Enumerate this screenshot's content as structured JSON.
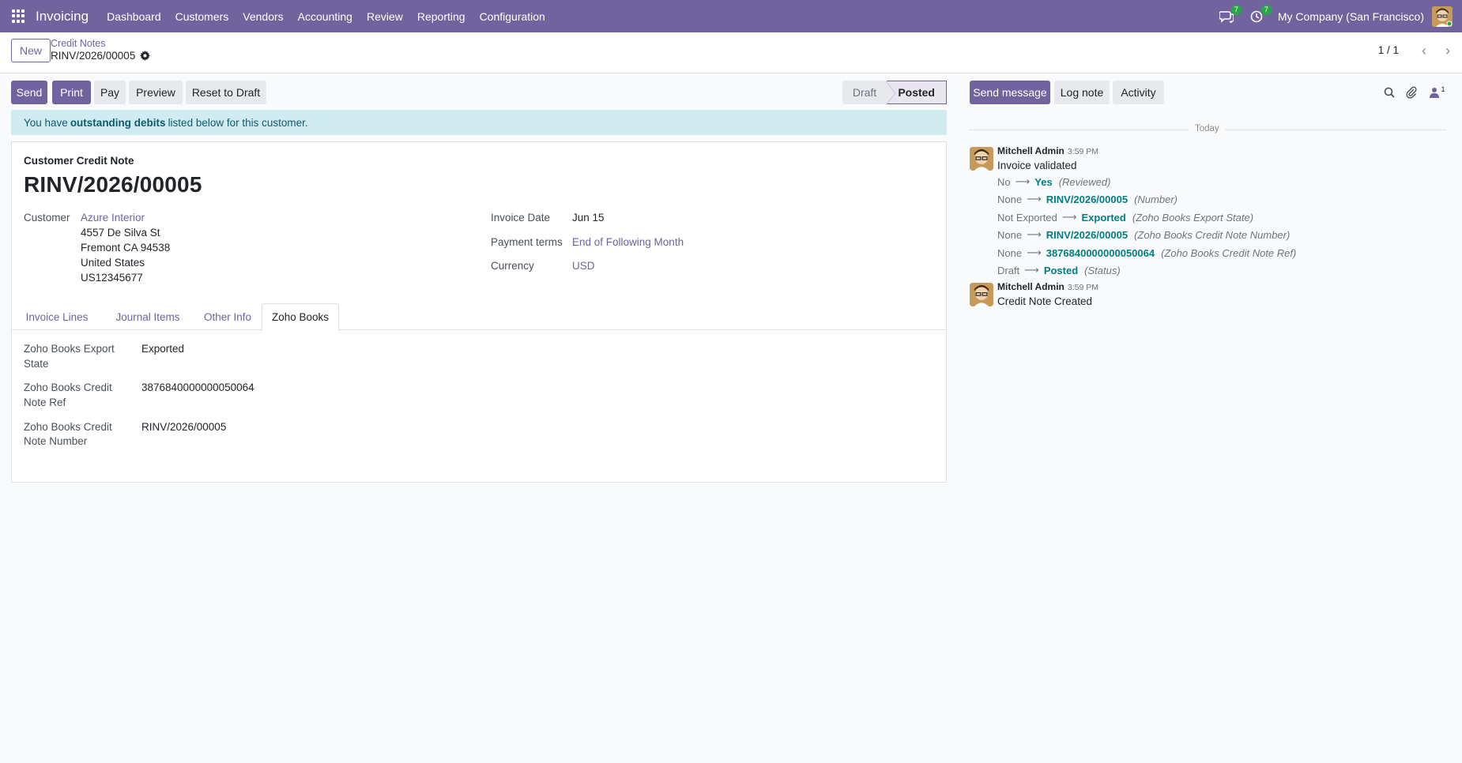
{
  "navbar": {
    "app_name": "Invoicing",
    "menu": [
      "Dashboard",
      "Customers",
      "Vendors",
      "Accounting",
      "Review",
      "Reporting",
      "Configuration"
    ],
    "messages_badge": "7",
    "activities_badge": "7",
    "company": "My Company (San Francisco)",
    "accent_color": "#71639e"
  },
  "control": {
    "new_label": "New",
    "breadcrumb_parent": "Credit Notes",
    "breadcrumb_current": "RINV/2026/00005",
    "pager": "1 / 1"
  },
  "actions": {
    "send": "Send",
    "print": "Print",
    "pay": "Pay",
    "preview": "Preview",
    "reset": "Reset to Draft"
  },
  "statusbar": {
    "draft": "Draft",
    "posted": "Posted",
    "current": "Posted"
  },
  "alert": {
    "prefix": "You have",
    "bold": "outstanding debits",
    "suffix": "listed below for this customer."
  },
  "form": {
    "doc_type": "Customer Credit Note",
    "doc_name": "RINV/2026/00005",
    "customer_label": "Customer",
    "customer_name": "Azure Interior",
    "address": [
      "4557 De Silva St",
      "Fremont CA 94538",
      "United States",
      "US12345677"
    ],
    "invoice_date_label": "Invoice Date",
    "invoice_date": "Jun 15",
    "payment_terms_label": "Payment terms",
    "payment_terms": "End of Following Month",
    "currency_label": "Currency",
    "currency": "USD"
  },
  "tabs": [
    "Invoice Lines",
    "Journal Items",
    "Other Info",
    "Zoho Books"
  ],
  "active_tab": "Zoho Books",
  "zoho": {
    "export_state_label": [
      "Zoho Books Export",
      "State"
    ],
    "export_state": "Exported",
    "credit_ref_label": [
      "Zoho Books Credit",
      "Note Ref"
    ],
    "credit_ref": "3876840000000050064",
    "credit_number_label": [
      "Zoho Books Credit",
      "Note Number"
    ],
    "credit_number": "RINV/2026/00005"
  },
  "chatter": {
    "send_message": "Send message",
    "log_note": "Log note",
    "activity": "Activity",
    "followers_count": "1",
    "today": "Today",
    "messages": [
      {
        "author": "Mitchell Admin",
        "time": "3:59 PM",
        "body": "Invoice validated",
        "tracking": [
          {
            "old": "No",
            "new": "Yes",
            "field": "(Reviewed)"
          },
          {
            "old": "None",
            "new": "RINV/2026/00005",
            "field": "(Number)"
          },
          {
            "old": "Not Exported",
            "new": "Exported",
            "field": "(Zoho Books Export State)"
          },
          {
            "old": "None",
            "new": "RINV/2026/00005",
            "field": "(Zoho Books Credit Note Number)"
          },
          {
            "old": "None",
            "new": "3876840000000050064",
            "field": "(Zoho Books Credit Note Ref)"
          },
          {
            "old": "Draft",
            "new": "Posted",
            "field": "(Status)"
          }
        ]
      },
      {
        "author": "Mitchell Admin",
        "time": "3:59 PM",
        "body": "Credit Note Created",
        "tracking": []
      }
    ]
  }
}
